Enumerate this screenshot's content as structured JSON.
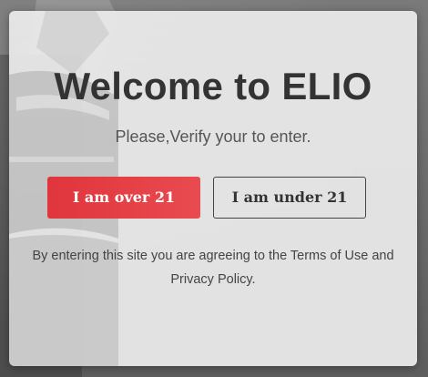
{
  "modal": {
    "title": "Welcome to ELIO",
    "subtitle": "Please,Verify your to enter.",
    "buttons": {
      "over_21": "I am over 21",
      "under_21": "I am under 21"
    },
    "disclaimer": "By entering this site you are agreeing to the Terms of Use and Privacy Policy."
  },
  "colors": {
    "primary_button": "#e0353c",
    "title_text": "#333333",
    "modal_background": "#e9e9e9"
  }
}
